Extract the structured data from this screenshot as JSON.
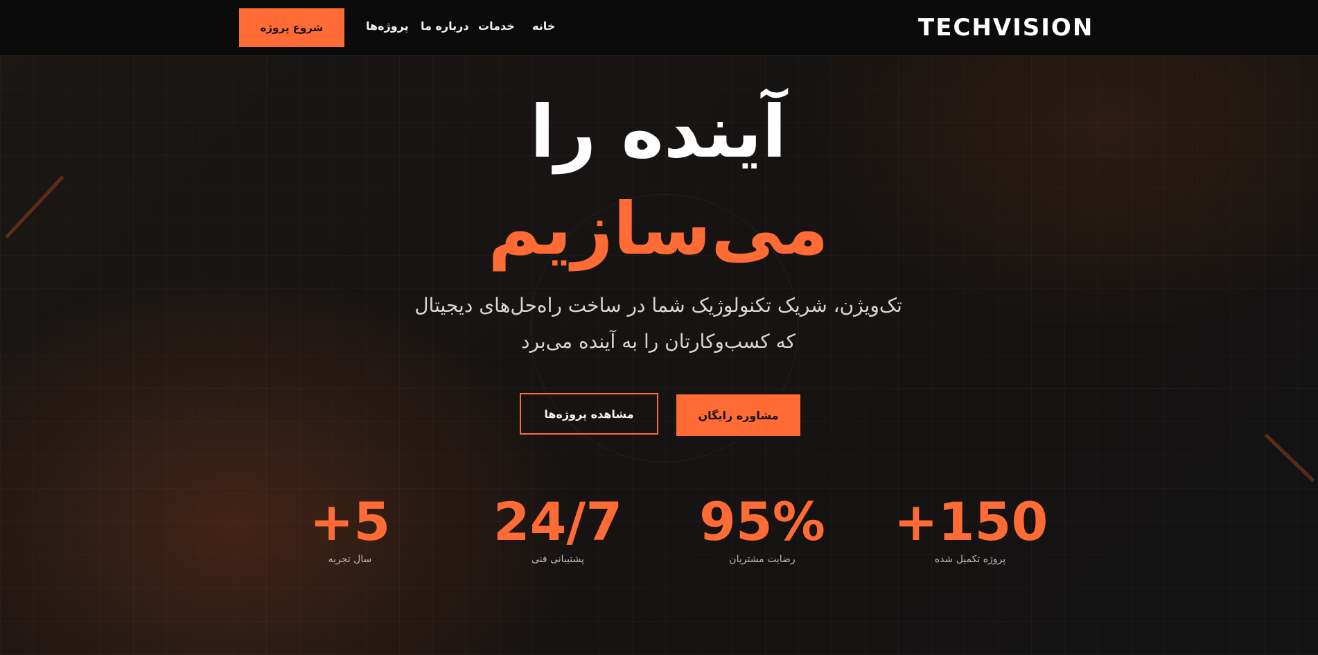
{
  "brand": {
    "logo_text": "TECHVISION",
    "accent_color": "#ff6b35"
  },
  "nav": {
    "links": [
      {
        "label": "خانه"
      },
      {
        "label": "خدمات"
      },
      {
        "label": "درباره ما"
      },
      {
        "label": "پروژه‌ها"
      }
    ],
    "cta_label": "شروع پروژه"
  },
  "hero": {
    "title_line1": "آینده را",
    "title_line2": "می‌سازیم",
    "subtitle_line1": "تک‌ویژن، شریک تکنولوژیک شما در ساخت راه‌حل‌های دیجیتال",
    "subtitle_line2": "که کسب‌وکارتان را به آینده می‌برد",
    "primary_button": "مشاوره رایگان",
    "secondary_button": "مشاهده پروژه‌ها"
  },
  "stats": [
    {
      "value": "+150",
      "label": "پروژه تکمیل شده"
    },
    {
      "value": "95%",
      "label": "رضایت مشتریان"
    },
    {
      "value": "24/7",
      "label": "پشتیبانی فنی"
    },
    {
      "value": "+5",
      "label": "سال تجربه"
    }
  ]
}
